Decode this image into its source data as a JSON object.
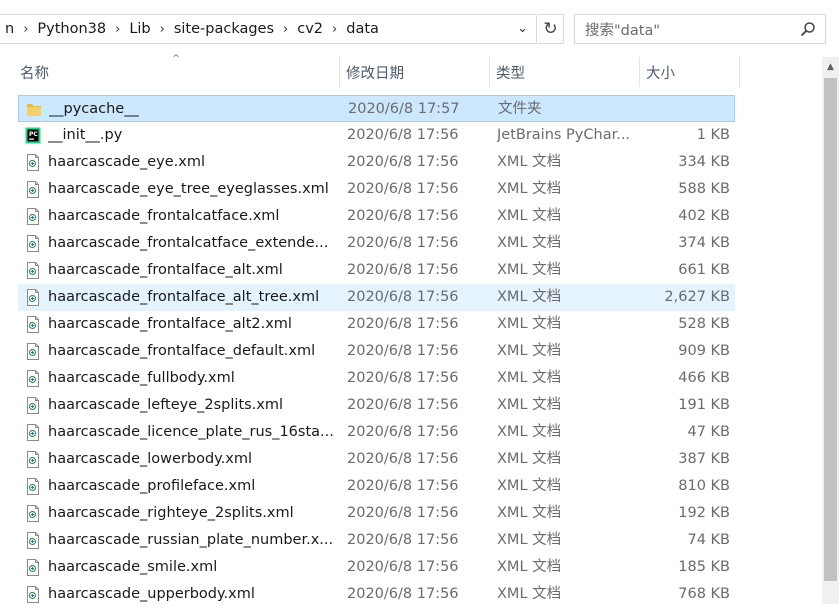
{
  "address": {
    "crumbs": [
      "n",
      "Python38",
      "Lib",
      "site-packages",
      "cv2",
      "data"
    ],
    "separator": "›",
    "dropdown": "⌄",
    "refresh": "↻"
  },
  "search": {
    "placeholder": "搜索\"data\"",
    "icon": "⌕"
  },
  "columns": {
    "name": "名称",
    "date": "修改日期",
    "type": "类型",
    "size": "大小",
    "sort_indicator": "⌃"
  },
  "files": [
    {
      "name": "__pycache__",
      "date": "2020/6/8 17:57",
      "type": "文件夹",
      "size": "",
      "icon": "folder-icon",
      "state": "selected"
    },
    {
      "name": "__init__.py",
      "date": "2020/6/8 17:56",
      "type": "JetBrains PyChar...",
      "size": "1 KB",
      "icon": "pycharm-file-icon",
      "state": ""
    },
    {
      "name": "haarcascade_eye.xml",
      "date": "2020/6/8 17:56",
      "type": "XML 文档",
      "size": "334 KB",
      "icon": "xml-file-icon",
      "state": ""
    },
    {
      "name": "haarcascade_eye_tree_eyeglasses.xml",
      "date": "2020/6/8 17:56",
      "type": "XML 文档",
      "size": "588 KB",
      "icon": "xml-file-icon",
      "state": ""
    },
    {
      "name": "haarcascade_frontalcatface.xml",
      "date": "2020/6/8 17:56",
      "type": "XML 文档",
      "size": "402 KB",
      "icon": "xml-file-icon",
      "state": ""
    },
    {
      "name": "haarcascade_frontalcatface_extende...",
      "date": "2020/6/8 17:56",
      "type": "XML 文档",
      "size": "374 KB",
      "icon": "xml-file-icon",
      "state": ""
    },
    {
      "name": "haarcascade_frontalface_alt.xml",
      "date": "2020/6/8 17:56",
      "type": "XML 文档",
      "size": "661 KB",
      "icon": "xml-file-icon",
      "state": ""
    },
    {
      "name": "haarcascade_frontalface_alt_tree.xml",
      "date": "2020/6/8 17:56",
      "type": "XML 文档",
      "size": "2,627 KB",
      "icon": "xml-file-icon",
      "state": "hover"
    },
    {
      "name": "haarcascade_frontalface_alt2.xml",
      "date": "2020/6/8 17:56",
      "type": "XML 文档",
      "size": "528 KB",
      "icon": "xml-file-icon",
      "state": ""
    },
    {
      "name": "haarcascade_frontalface_default.xml",
      "date": "2020/6/8 17:56",
      "type": "XML 文档",
      "size": "909 KB",
      "icon": "xml-file-icon",
      "state": ""
    },
    {
      "name": "haarcascade_fullbody.xml",
      "date": "2020/6/8 17:56",
      "type": "XML 文档",
      "size": "466 KB",
      "icon": "xml-file-icon",
      "state": ""
    },
    {
      "name": "haarcascade_lefteye_2splits.xml",
      "date": "2020/6/8 17:56",
      "type": "XML 文档",
      "size": "191 KB",
      "icon": "xml-file-icon",
      "state": ""
    },
    {
      "name": "haarcascade_licence_plate_rus_16sta...",
      "date": "2020/6/8 17:56",
      "type": "XML 文档",
      "size": "47 KB",
      "icon": "xml-file-icon",
      "state": ""
    },
    {
      "name": "haarcascade_lowerbody.xml",
      "date": "2020/6/8 17:56",
      "type": "XML 文档",
      "size": "387 KB",
      "icon": "xml-file-icon",
      "state": ""
    },
    {
      "name": "haarcascade_profileface.xml",
      "date": "2020/6/8 17:56",
      "type": "XML 文档",
      "size": "810 KB",
      "icon": "xml-file-icon",
      "state": ""
    },
    {
      "name": "haarcascade_righteye_2splits.xml",
      "date": "2020/6/8 17:56",
      "type": "XML 文档",
      "size": "192 KB",
      "icon": "xml-file-icon",
      "state": ""
    },
    {
      "name": "haarcascade_russian_plate_number.x...",
      "date": "2020/6/8 17:56",
      "type": "XML 文档",
      "size": "74 KB",
      "icon": "xml-file-icon",
      "state": ""
    },
    {
      "name": "haarcascade_smile.xml",
      "date": "2020/6/8 17:56",
      "type": "XML 文档",
      "size": "185 KB",
      "icon": "xml-file-icon",
      "state": ""
    },
    {
      "name": "haarcascade_upperbody.xml",
      "date": "2020/6/8 17:56",
      "type": "XML 文档",
      "size": "768 KB",
      "icon": "xml-file-icon",
      "state": ""
    }
  ],
  "colors": {
    "selected_bg": "#cce8ff",
    "selected_border": "#99d1ff",
    "hover_bg": "#e5f3ff",
    "folder": "#e8b84a",
    "header_text": "#4d5b6e"
  },
  "scrollbar": {
    "up_arrow": "▲"
  }
}
